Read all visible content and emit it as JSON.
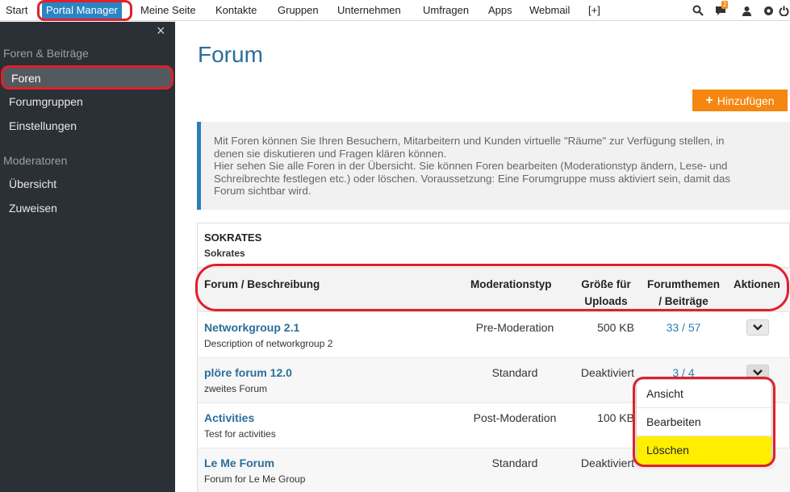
{
  "topnav": {
    "items": [
      {
        "label": "Start"
      },
      {
        "label": "Portal Manager"
      },
      {
        "label": "Meine Seite"
      },
      {
        "label": "Kontakte"
      },
      {
        "label": "Gruppen"
      },
      {
        "label": "Unternehmen"
      },
      {
        "label": "Umfragen"
      },
      {
        "label": "Apps"
      },
      {
        "label": "Webmail"
      },
      {
        "label": "[+]"
      }
    ],
    "active_item": "Portal Manager",
    "message_badge": "2",
    "icons": [
      "search-icon",
      "chat-icon",
      "user-icon",
      "globe-icon",
      "power-icon"
    ]
  },
  "sidebar": {
    "close_glyph": "×",
    "sections": [
      {
        "title": "Foren & Beiträge",
        "items": [
          {
            "label": "Foren"
          },
          {
            "label": "Forumgruppen"
          },
          {
            "label": "Einstellungen"
          }
        ]
      },
      {
        "title": "Moderatoren",
        "items": [
          {
            "label": "Übersicht"
          },
          {
            "label": "Zuweisen"
          }
        ]
      }
    ],
    "selected_item": "Foren"
  },
  "main": {
    "title": "Forum",
    "add_button": "Hinzufügen",
    "info_lines": [
      "Mit Foren können Sie Ihren Besuchern, Mitarbeitern und Kunden virtuelle \"Räume\" zur Verfügung stellen, in",
      "denen sie diskutieren und Fragen klären können.",
      "Hier sehen Sie alle Foren in der Übersicht. Sie können Foren bearbeiten (Moderationstyp ändern, Lese- und",
      "Schreibrechte festlegen etc.) oder löschen. Voraussetzung: Eine Forumgruppe muss aktiviert sein, damit das",
      "Forum sichtbar wird."
    ]
  },
  "forum_group": {
    "title": "SOKRATES",
    "subtitle": "Sokrates",
    "columns": {
      "name": "Forum / Beschreibung",
      "moderation": "Moderationstyp",
      "size_line1": "Größe für",
      "size_line2": "Uploads",
      "topics_line1": "Forumthemen",
      "topics_line2": "/ Beiträge",
      "actions": "Aktionen"
    },
    "rows": [
      {
        "name": "Networkgroup 2.1",
        "description": "Description of networkgroup 2",
        "moderation": "Pre-Moderation",
        "size": "500 KB",
        "counts": "33 / 57"
      },
      {
        "name": "plöre forum 12.0",
        "description": "zweites Forum",
        "moderation": "Standard",
        "size": "Deaktiviert",
        "counts": "3 / 4"
      },
      {
        "name": "Activities",
        "description": "Test for activities",
        "moderation": "Post-Moderation",
        "size": "100 KB",
        "counts": ""
      },
      {
        "name": "Le Me Forum",
        "description": "Forum for Le Me Group",
        "moderation": "Standard",
        "size": "Deaktiviert",
        "counts": ""
      }
    ]
  },
  "action_menu": {
    "items": [
      "Ansicht",
      "Bearbeiten",
      "Löschen"
    ],
    "highlighted": "Löschen"
  },
  "colors": {
    "accent_blue": "#2a84c4",
    "sidebar_bg": "#2b2f36",
    "add_button_orange": "#f5860f",
    "annotation_red": "#e0202b",
    "highlight_yellow": "#ffee00"
  }
}
